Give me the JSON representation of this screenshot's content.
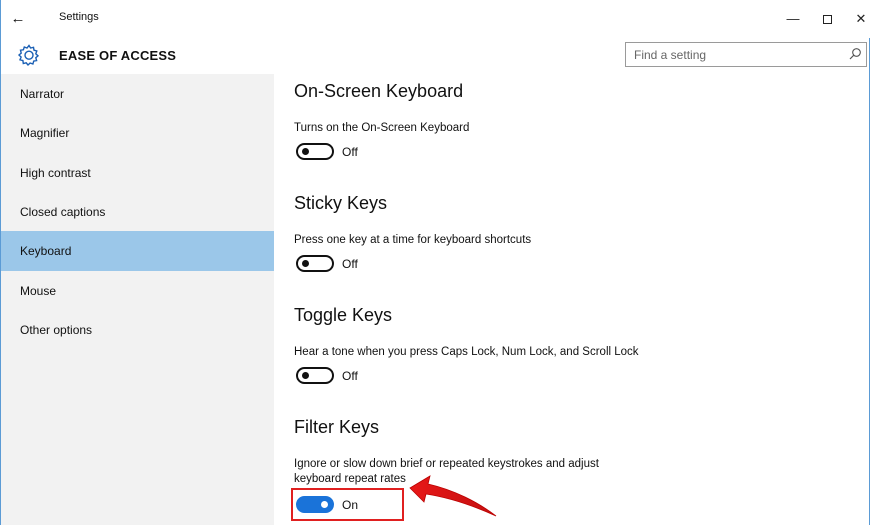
{
  "titlebar": {
    "back_glyph": "←",
    "title": "Settings",
    "minimize_glyph": "—",
    "close_glyph": "✕"
  },
  "header": {
    "title": "EASE OF ACCESS",
    "search_placeholder": "Find a setting"
  },
  "sidebar": {
    "items": [
      {
        "label": "Narrator"
      },
      {
        "label": "Magnifier"
      },
      {
        "label": "High contrast"
      },
      {
        "label": "Closed captions"
      },
      {
        "label": "Keyboard",
        "selected": true
      },
      {
        "label": "Mouse"
      },
      {
        "label": "Other options"
      }
    ]
  },
  "main": {
    "sections": [
      {
        "title": "On-Screen Keyboard",
        "description": "Turns on the On-Screen Keyboard",
        "toggle_state": "Off"
      },
      {
        "title": "Sticky Keys",
        "description": "Press one key at a time for keyboard shortcuts",
        "toggle_state": "Off"
      },
      {
        "title": "Toggle Keys",
        "description": "Hear a tone when you press Caps Lock, Num Lock, and Scroll Lock",
        "toggle_state": "Off"
      },
      {
        "title": "Filter Keys",
        "description_line1": "Ignore or slow down brief or repeated keystrokes and adjust",
        "description_line2": "keyboard repeat rates",
        "toggle_state": "On"
      }
    ]
  },
  "colors": {
    "accent": "#1a73d9",
    "selected_nav": "#9bc7e9",
    "sidebar_bg": "#f2f2f2",
    "annotation": "#e02020"
  },
  "icons": {
    "header": "gear-icon",
    "search": "search-icon",
    "back": "back-arrow-icon"
  }
}
